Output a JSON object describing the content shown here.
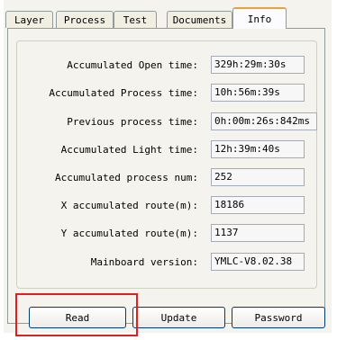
{
  "tabs": [
    {
      "label": "Layer"
    },
    {
      "label": "Process"
    },
    {
      "label": "Test"
    },
    {
      "label": "Documents"
    },
    {
      "label": "Info"
    }
  ],
  "active_tab": "Info",
  "info": {
    "rows": [
      {
        "label": "Accumulated Open time:",
        "value": "329h:29m:30s"
      },
      {
        "label": "Accumulated Process time:",
        "value": "10h:56m:39s"
      },
      {
        "label": "Previous process time:",
        "value": "0h:00m:26s:842ms"
      },
      {
        "label": "Accumulated Light time:",
        "value": "12h:39m:40s"
      },
      {
        "label": "Accumulated process num:",
        "value": "252"
      },
      {
        "label": "X accumulated route(m):",
        "value": "18186"
      },
      {
        "label": "Y accumulated route(m):",
        "value": "1137"
      },
      {
        "label": "Mainboard version:",
        "value": "YMLC-V8.02.38"
      }
    ]
  },
  "buttons": {
    "read": "Read",
    "update": "Update",
    "password": "Password"
  },
  "colors": {
    "highlight": "#e02020",
    "active_tab_accent": "#e8a23a"
  }
}
